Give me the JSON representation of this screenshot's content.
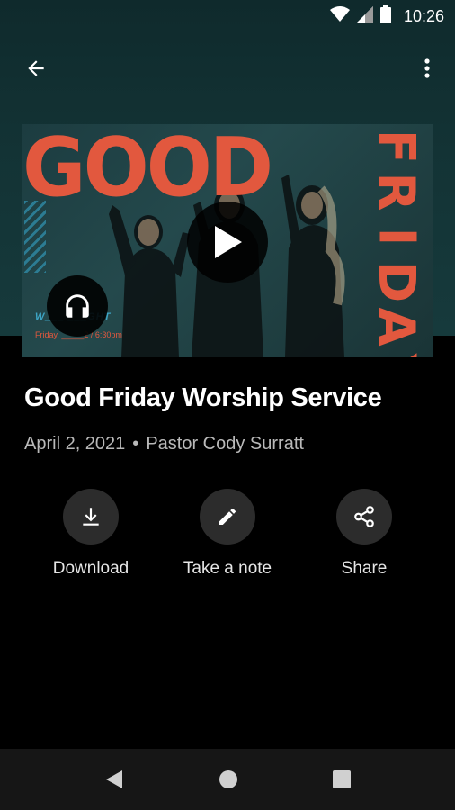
{
  "status_bar": {
    "time": "10:26",
    "icons": [
      "wifi-icon",
      "signal-icon",
      "battery-icon"
    ]
  },
  "toolbar": {
    "back_icon": "arrow-back-icon",
    "overflow_icon": "more-vert-icon"
  },
  "artwork": {
    "word_top": "GOOD",
    "word_side": [
      "F",
      "R",
      "I",
      "D",
      "A",
      "Y"
    ],
    "subtitle": "W___ ___GHT",
    "date_line": "Friday, _____2 / 6:30pm",
    "accent_color": "#e2583e",
    "secondary_color": "#3da4c4",
    "play_icon": "play-icon",
    "audio_icon": "headphones-icon"
  },
  "sermon": {
    "title": "Good Friday Worship Service",
    "date": "April 2, 2021",
    "separator": "•",
    "speaker": "Pastor Cody Surratt"
  },
  "actions": [
    {
      "label": "Download",
      "icon": "download-icon"
    },
    {
      "label": "Take a note",
      "icon": "pencil-icon"
    },
    {
      "label": "Share",
      "icon": "share-icon"
    }
  ],
  "nav_bar": {
    "icons": [
      "nav-back-icon",
      "nav-home-icon",
      "nav-recents-icon"
    ]
  }
}
